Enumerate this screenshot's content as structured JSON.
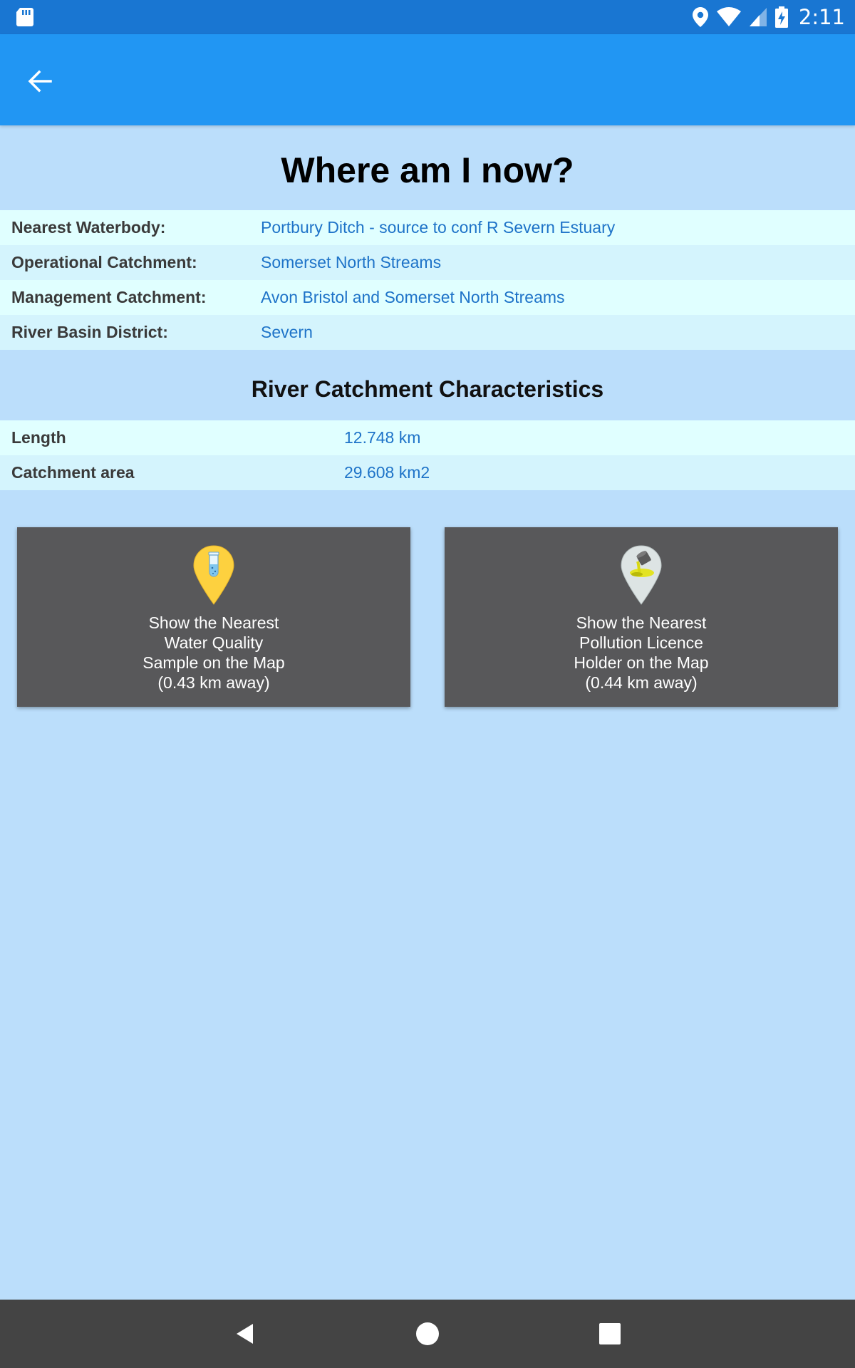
{
  "status_bar": {
    "time": "2:11",
    "icons": [
      "sd-card-icon",
      "location-icon",
      "wifi-icon",
      "cellular-signal-icon",
      "battery-charging-icon"
    ]
  },
  "app_bar": {
    "back_icon": "arrow-back-icon"
  },
  "page": {
    "title": "Where am I now?"
  },
  "location_info": [
    {
      "label": "Nearest Waterbody:",
      "value": "Portbury Ditch - source to conf R Severn Estuary"
    },
    {
      "label": "Operational Catchment:",
      "value": "Somerset North Streams"
    },
    {
      "label": "Management Catchment:",
      "value": "Avon Bristol and Somerset North Streams"
    },
    {
      "label": "River Basin District:",
      "value": "Severn"
    }
  ],
  "characteristics": {
    "title": "River Catchment Characteristics",
    "rows": [
      {
        "label": "Length",
        "value": "12.748 km"
      },
      {
        "label": "Catchment area",
        "value": "29.608 km2"
      }
    ]
  },
  "actions": {
    "water_quality": {
      "icon": "test-tube-pin-icon",
      "lines": [
        "Show the Nearest",
        "Water Quality",
        "Sample on the Map",
        "(0.43 km away)"
      ]
    },
    "pollution_licence": {
      "icon": "pollution-pin-icon",
      "lines": [
        "Show the Nearest",
        "Pollution Licence",
        "Holder on the Map",
        "(0.44 km away)"
      ]
    }
  },
  "nav_bar": {
    "icons": [
      "nav-back-icon",
      "nav-home-icon",
      "nav-recents-icon"
    ]
  },
  "colors": {
    "status_bar": "#1976d2",
    "app_bar": "#2196f3",
    "background": "#bbdefb",
    "row_light": "#e0ffff",
    "row_alt": "#d4f4fd",
    "value_text": "#1e73c8",
    "card": "#58585a",
    "nav_bar": "#444444"
  }
}
